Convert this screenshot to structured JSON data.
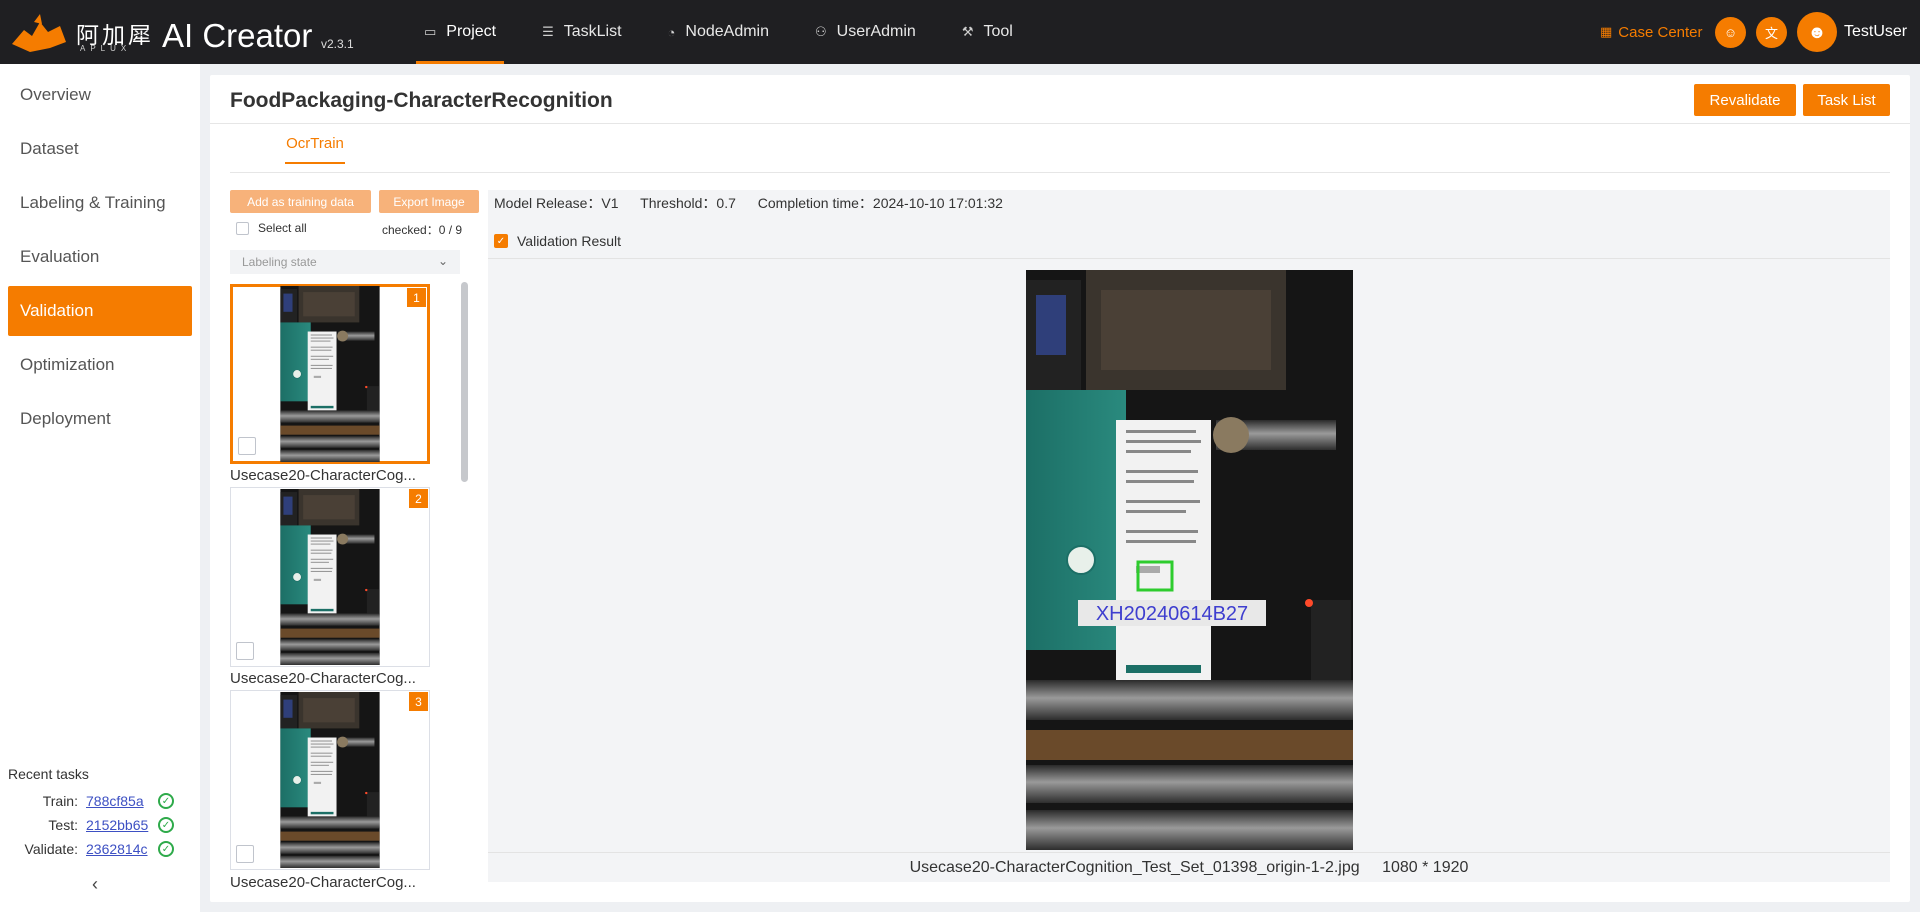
{
  "app": {
    "brand_cn": "阿加犀",
    "brand_sub": "APLUX",
    "title": "AI Creator",
    "version": "v2.3.1"
  },
  "nav": [
    {
      "label": "Project",
      "icon": "folder-icon",
      "active": true
    },
    {
      "label": "TaskList",
      "icon": "list-icon"
    },
    {
      "label": "NodeAdmin",
      "icon": "node-icon"
    },
    {
      "label": "UserAdmin",
      "icon": "users-icon"
    },
    {
      "label": "Tool",
      "icon": "wrench-icon"
    }
  ],
  "header_right": {
    "case_center": "Case Center",
    "round_buttons": [
      "cat-icon",
      "translate-icon"
    ],
    "username": "TestUser"
  },
  "sidebar": {
    "items": [
      "Overview",
      "Dataset",
      "Labeling & Training",
      "Evaluation",
      "Validation",
      "Optimization",
      "Deployment"
    ],
    "active": "Validation",
    "recent_title": "Recent tasks",
    "recent": [
      {
        "label": "Train:",
        "id": "788cf85a"
      },
      {
        "label": "Test:",
        "id": "2152bb65"
      },
      {
        "label": "Validate:",
        "id": "2362814c"
      }
    ],
    "collapse": "‹"
  },
  "page": {
    "title": "FoodPackaging-CharacterRecognition",
    "revalidate": "Revalidate",
    "task_list": "Task List",
    "tab": "OcrTrain"
  },
  "list": {
    "add_training": "Add as training data",
    "export_image": "Export Image",
    "select_all": "Select all",
    "checked": "checked：0 / 9",
    "labeling_state": "Labeling state",
    "items": [
      {
        "num": "1",
        "label": "Usecase20-CharacterCog..."
      },
      {
        "num": "2",
        "label": "Usecase20-CharacterCog..."
      },
      {
        "num": "3",
        "label": "Usecase20-CharacterCog..."
      }
    ]
  },
  "detail": {
    "model_release": "Model Release：V1",
    "threshold": "Threshold：0.7",
    "completion": "Completion time：2024-10-10 17:01:32",
    "validation_result": "Validation Result",
    "ocr_text": "XH20240614B27",
    "filename": "Usecase20-CharacterCognition_Test_Set_01398_origin-1-2.jpg",
    "dims": "1080 * 1920"
  },
  "colors": {
    "accent": "#f57c00",
    "topbar": "#1f1f22",
    "link": "#3d50c3",
    "ok": "#2eaa4a"
  }
}
